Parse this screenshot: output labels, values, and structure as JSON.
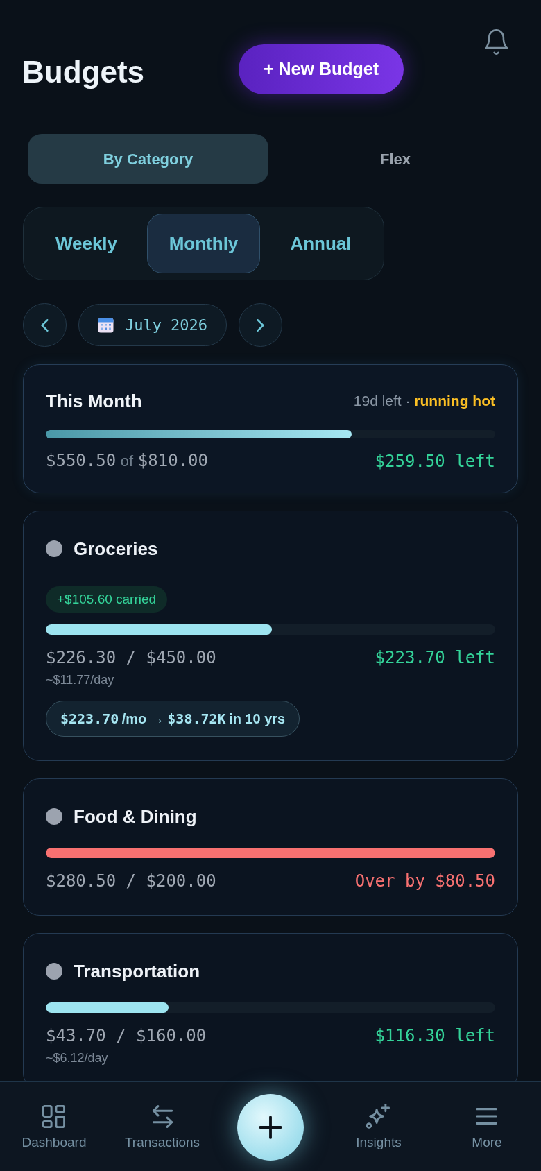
{
  "header": {
    "title": "Budgets",
    "new_button": "+ New Budget"
  },
  "view_toggle": [
    {
      "label": "By Category",
      "selected": true
    },
    {
      "label": "Flex",
      "selected": false
    }
  ],
  "period_tabs": [
    {
      "label": "Weekly",
      "selected": false
    },
    {
      "label": "Monthly",
      "selected": true
    },
    {
      "label": "Annual",
      "selected": false
    }
  ],
  "date_picker": {
    "label": "July 2026"
  },
  "summary": {
    "title": "This Month",
    "status": "19d left · **running hot**",
    "level": 0.68,
    "spent": "$550.50",
    "joiner": "of",
    "total": "$810.00",
    "remaining": "$259.50 left"
  },
  "categories": [
    {
      "name": "Groceries",
      "color": "#9ca3af",
      "carried": "+$105.60 carried",
      "level": 0.503,
      "over": false,
      "amounts": "$226.30 / $450.00",
      "remaining": "$223.70 left",
      "per_day": "~$11.77/day",
      "projection": [
        {
          "kind": "amount",
          "text": "$223.70"
        },
        {
          "kind": "label",
          "text": "/mo →"
        },
        {
          "kind": "amount",
          "text": "$38.72K"
        },
        {
          "kind": "label",
          "text": "in 10 yrs"
        }
      ]
    },
    {
      "name": "Food & Dining",
      "color": "#9ca3af",
      "level": 1,
      "over": true,
      "amounts": "$280.50 / $200.00",
      "remaining": "Over by $80.50"
    },
    {
      "name": "Transportation",
      "color": "#9ca3af",
      "level": 0.273,
      "over": false,
      "amounts": "$43.70 / $160.00",
      "remaining": "$116.30 left",
      "per_day": "~$6.12/day"
    }
  ],
  "bottom_nav": [
    {
      "kind": "tab",
      "label": "Dashboard",
      "selected": false
    },
    {
      "kind": "tab",
      "label": "Transactions",
      "selected": false
    },
    {
      "kind": "add"
    },
    {
      "kind": "tab",
      "label": "Insights",
      "selected": false
    },
    {
      "kind": "tab",
      "label": "More",
      "selected": false
    }
  ]
}
